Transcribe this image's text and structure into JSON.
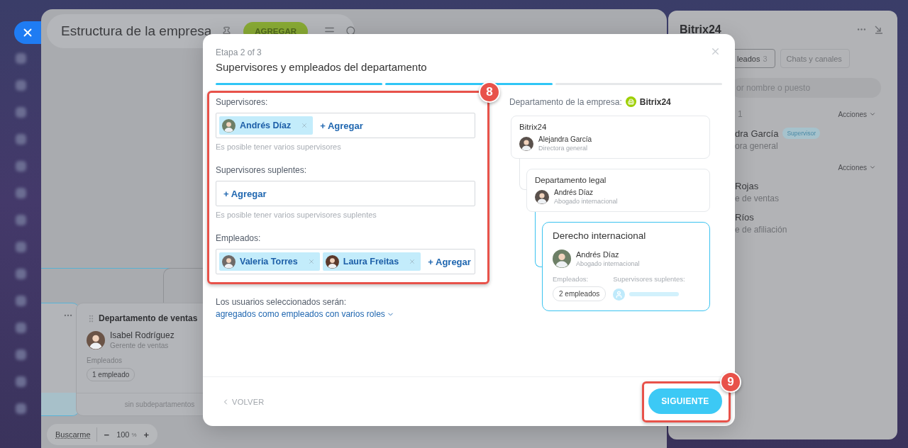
{
  "header": {
    "title": "Estructura de la empresa",
    "add_button": "AGREGAR"
  },
  "org_chart": {
    "cards": [
      {
        "kind": "partial",
        "selected": true
      },
      {
        "kind": "department",
        "selected": false,
        "title": "Departamento de ventas",
        "head": {
          "name": "Isabel Rodríguez",
          "role": "Gerente de ventas"
        },
        "employees_label": "Empleados",
        "employees_count": "1 empleado",
        "footer": "sin subdepartamentos"
      }
    ]
  },
  "zoom": {
    "find_me": "Buscarme",
    "minus": "−",
    "value": "100",
    "unit": "%",
    "plus": "+"
  },
  "right_panel": {
    "title": "Bitrix24",
    "tabs": [
      {
        "label": "leados",
        "count": "3",
        "selected": true
      },
      {
        "label": "Chats y canales",
        "selected": false
      }
    ],
    "search": {
      "placeholder": "or nombre o puesto"
    },
    "groups": [
      {
        "heading": "1",
        "actions": "Acciones",
        "members": [
          {
            "name": "dra García",
            "badge": "Supervisor",
            "role": "ora general"
          }
        ]
      },
      {
        "actions": "Acciones",
        "members": [
          {
            "name": "Rojas",
            "role": "e de ventas"
          },
          {
            "name": "Ríos",
            "role": "e de afiliación"
          }
        ]
      }
    ]
  },
  "modal": {
    "step": "Etapa 2 of 3",
    "title": "Supervisores y empleados del departamento",
    "steps": [
      {
        "completed": true
      },
      {
        "completed": true
      },
      {
        "completed": false
      }
    ],
    "fields": [
      {
        "label": "Supervisores:",
        "chips": [
          {
            "name": "Andrés Díaz"
          }
        ],
        "add": "+ Agregar",
        "hint": "Es posible tener varios supervisores"
      },
      {
        "label": "Supervisores suplentes:",
        "add": "+ Agregar",
        "hint": "Es posible tener varios supervisores suplentes"
      },
      {
        "label": "Empleados:",
        "chips": [
          {
            "name": "Valeria Torres"
          },
          {
            "name": "Laura Freitas"
          }
        ],
        "add": "+ Agregar"
      }
    ],
    "result": {
      "label": "Los usuarios seleccionados serán:",
      "link": "agregados como empleados con varios roles"
    },
    "department": {
      "label": "Departamento de la empresa:",
      "company": "Bitrix24",
      "tree": [
        {
          "kind": "compact",
          "selected": false,
          "title": "Bitrix24",
          "head": {
            "name": "Alejandra García",
            "role": "Directora general"
          },
          "children": [
            {
              "kind": "compact",
              "selected": false,
              "title": "Departamento legal",
              "head": {
                "name": "Andrés Díaz",
                "role": "Abogado internacional"
              },
              "children": [
                {
                  "kind": "detailed",
                  "selected": true,
                  "title": "Derecho internacional",
                  "head": {
                    "name": "Andrés Díaz",
                    "role": "Abogado internacional"
                  },
                  "employees_label": "Empleados:",
                  "employees_count": "2 empleados",
                  "deputies_label": "Supervisores suplentes:"
                }
              ]
            }
          ]
        }
      ]
    },
    "back": "VOLVER",
    "next": "SIGUIENTE"
  },
  "annotations": [
    {
      "number": "8"
    },
    {
      "number": "9"
    }
  ]
}
